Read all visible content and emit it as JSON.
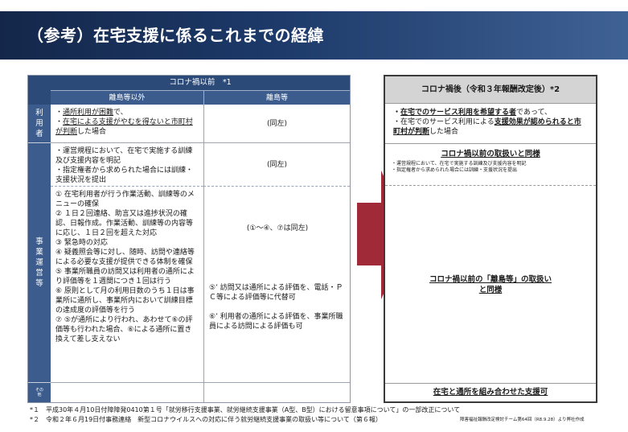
{
  "title": "（参考）在宅支援に係るこれまでの経緯",
  "left_table": {
    "header": "コロナ禍以前　*1",
    "col1": "離島等以外",
    "col2": "離島等",
    "side_user": "利用者",
    "side_office": "事業運営等",
    "side_other": "その他",
    "user_a": {
      "l1_pre": "・",
      "l1_u": "通所利用が困難",
      "l1_post": "で、",
      "l2_pre": "・",
      "l2_u": "在宅による支援がやむを得ないと市町村が判断",
      "l2_post": "した場合"
    },
    "user_b": "(同左)",
    "ops_a": [
      "・運営規程において、在宅で実施する訓練及び支援内容を明記",
      "・指定権者から求められた場合には訓練・支援状況を提出"
    ],
    "ops_b": "(同左)",
    "items_a": [
      "① 在宅利用者が行う作業活動、訓練等のメニューの確保",
      "② １日２回連絡、助言又は進捗状況の確認、日報作成。作業活動、訓練等の内容等に応じ、１日２回を超えた対応",
      "③ 緊急時の対応",
      "④ 疑義照会等に対し、随時、訪問や連絡等による必要な支援が提供できる体制を確保",
      "⑤ 事業所職員の訪問又は利用者の通所により評価等を１週間につき１回は行う",
      "⑥ 原則として月の利用日数のうち１日は事業所に通所し、事業所内において訓練目標の達成度の評価等を行う",
      "⑦ ⑤が通所により行われ、あわせて⑥の評価等も行われた場合、⑥による通所に置き換えて差し支えない"
    ],
    "items_b_same": "(①～④、⑦は同左)",
    "items_b_prime": [
      "⑤’ 訪問又は通所による評価を、電話・ＰＣ等による評価等に代替可",
      "⑥’ 利用者の通所による評価を、事業所職員による訪問による評価も可"
    ]
  },
  "right_table": {
    "header": "コロナ禍後（令和３年報酬改定後）*2",
    "cond_1_pre": "・",
    "cond_1_u": "在宅でのサービス利用を希望する者",
    "cond_1_post": "であって、",
    "cond_2_pre": "・在宅でのサービス利用による",
    "cond_2_u": "支援効果が認められると市町村が判断",
    "cond_2_post": "した場合",
    "sec1_title": "コロナ禍以前の取扱いと同様",
    "sec1_items": [
      "・運営規程において、在宅で実施する訓練及び支援内容を明記",
      "・指定権者から求められた場合には訓練・支援状況を提出"
    ],
    "sec2_title_1": "コロナ禍以前の「離島等」の取扱い",
    "sec2_title_2": "と同様",
    "sec3_title": "在宅と通所を組み合わせた支援可"
  },
  "footnotes": {
    "n1": "*１　平成30年４月10日付障障発0410第１号「就労移行支援事業、就労継続支援事業（A型、B型）における留意事項について」の一部改正について",
    "n2": "*２　令和２年６月19日付事務連絡　新型コロナウイルスへの対応に伴う就労継続支援事業の取扱い等について（第６報）",
    "source": "障害福祉報酬改定検討チーム第64回（R8.9.28）より弊社作成"
  },
  "colors": {
    "title_bg": "#1d3a6a",
    "header_blue": "#2b4a78",
    "arrow": "#a02a38",
    "right_header": "#d4d4d4"
  }
}
